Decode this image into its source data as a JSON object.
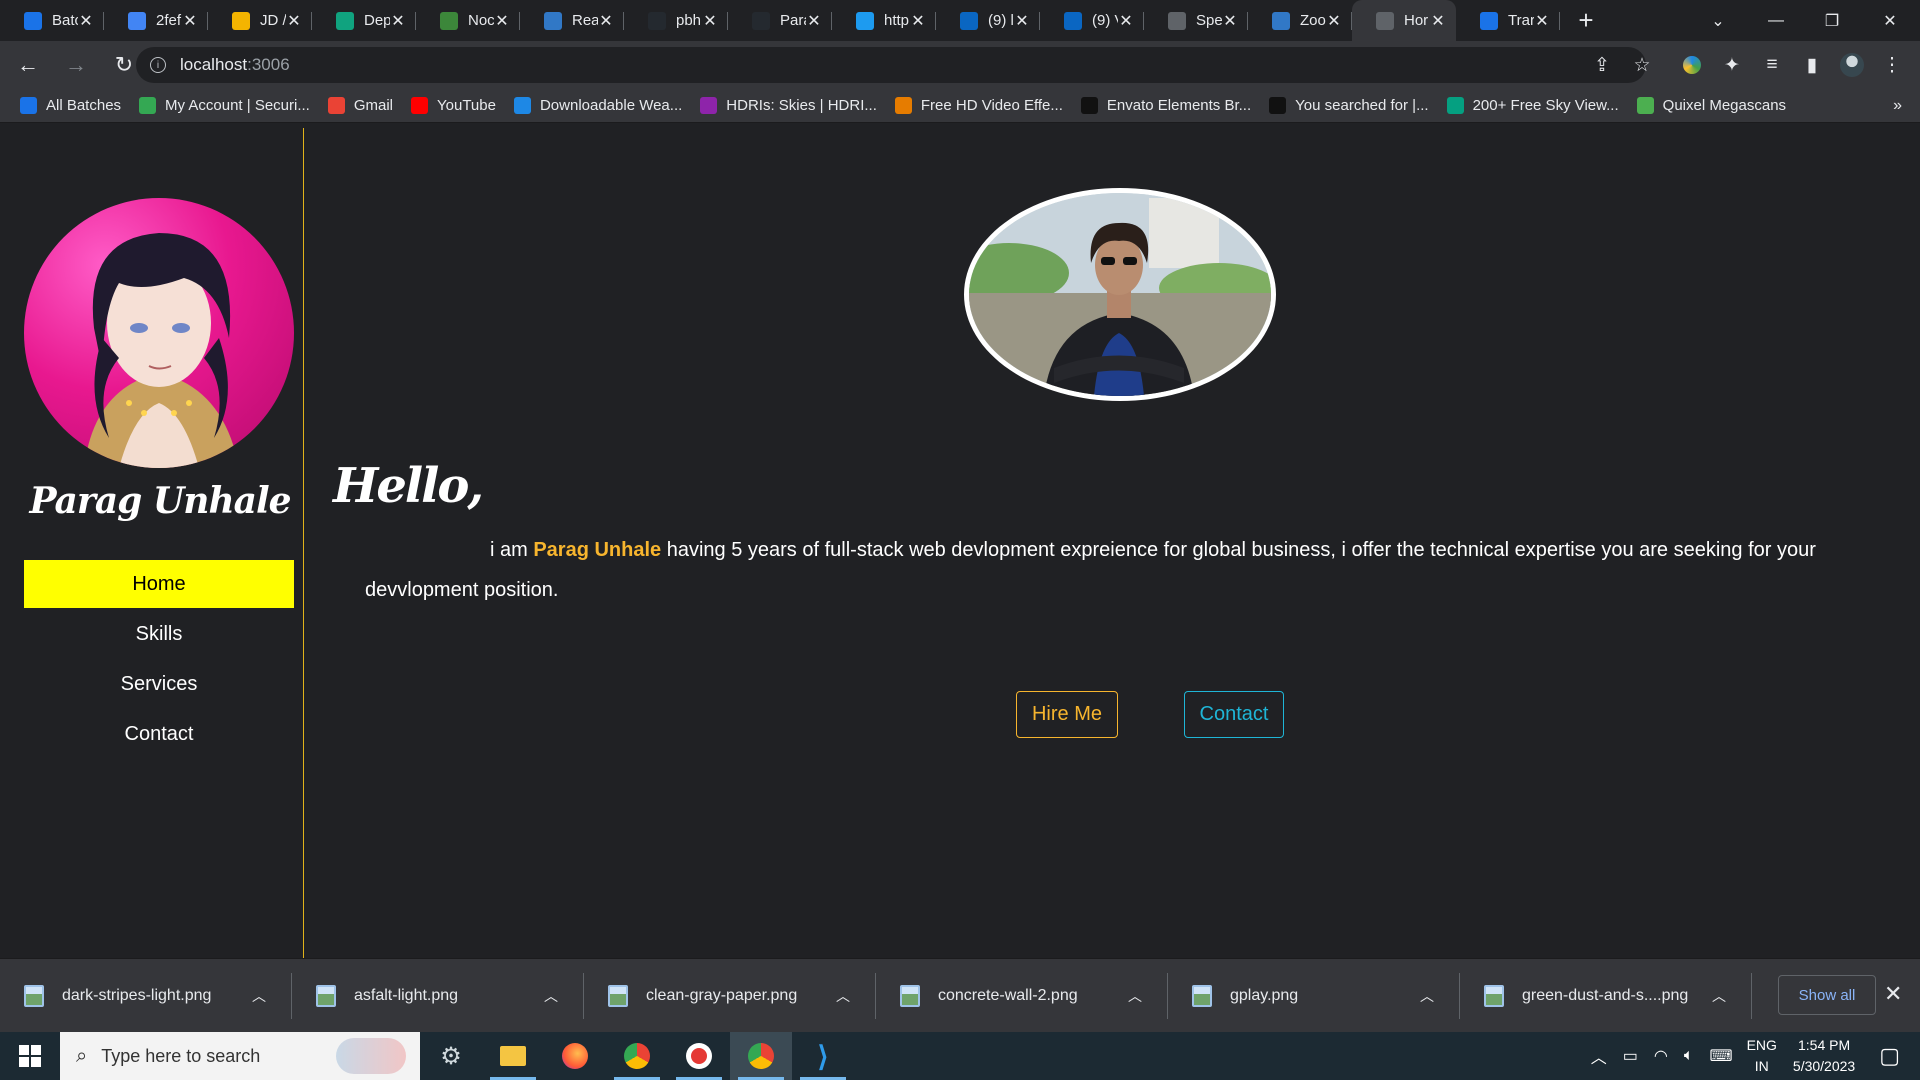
{
  "browser": {
    "tabs": [
      {
        "label": "Batc",
        "icon": "cursor-arrow-icon",
        "color": "#1a73e8"
      },
      {
        "label": "2fef",
        "icon": "docs-icon",
        "color": "#4285f4"
      },
      {
        "label": "JD /",
        "icon": "drive-icon",
        "color": "#f4b400"
      },
      {
        "label": "Dep",
        "icon": "openai-icon",
        "color": "#10a37f"
      },
      {
        "label": "Noc",
        "icon": "nodejs-icon",
        "color": "#3c873a"
      },
      {
        "label": "Rea",
        "icon": "vitejs-icon",
        "color": "#3178c6"
      },
      {
        "label": "pbh",
        "icon": "github-icon",
        "color": "#24292f"
      },
      {
        "label": "Para",
        "icon": "github-icon",
        "color": "#24292f"
      },
      {
        "label": "http",
        "icon": "twitter-icon",
        "color": "#1d9bf0"
      },
      {
        "label": "(9) l",
        "icon": "linkedin-icon",
        "color": "#0a66c2"
      },
      {
        "label": "(9) V",
        "icon": "linkedin-icon",
        "color": "#0a66c2"
      },
      {
        "label": "Spe",
        "icon": "globe-icon",
        "color": "#5f6368"
      },
      {
        "label": "Zoo",
        "icon": "vitejs-icon",
        "color": "#3178c6"
      },
      {
        "label": "Hor",
        "icon": "globe-icon",
        "color": "#5f6368"
      },
      {
        "label": "Trar",
        "icon": "tt-icon",
        "color": "#1a73e8"
      }
    ],
    "url": {
      "host": "localhost",
      "port": ":3006"
    }
  },
  "bookmarks": [
    {
      "label": "All Batches",
      "icon": "cursor-arrow-icon",
      "color": "#1a73e8"
    },
    {
      "label": "My Account | Securi...",
      "icon": "account-icon",
      "color": "#34a853"
    },
    {
      "label": "Gmail",
      "icon": "gmail-icon",
      "color": "#ea4335"
    },
    {
      "label": "YouTube",
      "icon": "youtube-icon",
      "color": "#ff0000"
    },
    {
      "label": "Downloadable Wea...",
      "icon": "weather-icon",
      "color": "#1e88e5"
    },
    {
      "label": "HDRIs: Skies | HDRI...",
      "icon": "hdri-icon",
      "color": "#8e24aa"
    },
    {
      "label": "Free HD Video Effe...",
      "icon": "video-icon",
      "color": "#e67c00"
    },
    {
      "label": "Envato Elements Br...",
      "icon": "tiktok-icon",
      "color": "#111"
    },
    {
      "label": "You searched for |...",
      "icon": "tiktok-icon",
      "color": "#111"
    },
    {
      "label": "200+ Free Sky View...",
      "icon": "pexels-icon",
      "color": "#05a081"
    },
    {
      "label": "Quixel Megascans",
      "icon": "megascans-icon",
      "color": "#4caf50"
    }
  ],
  "sidebar": {
    "name": "Parag Unhale",
    "nav": [
      {
        "label": "Home",
        "active": true
      },
      {
        "label": "Skills",
        "active": false
      },
      {
        "label": "Services",
        "active": false
      },
      {
        "label": "Contact",
        "active": false
      }
    ]
  },
  "main": {
    "greeting": "Hello,",
    "intro_before": "i am ",
    "intro_name": "Parag Unhale",
    "intro_after": " having 5 years of full-stack web devlopment expreience for global business, i offer the technical expertise you are seeking for your devvlopment position.",
    "hire_label": "Hire Me",
    "contact_label": "Contact"
  },
  "downloads": {
    "items": [
      "dark-stripes-light.png",
      "asfalt-light.png",
      "clean-gray-paper.png",
      "concrete-wall-2.png",
      "gplay.png",
      "green-dust-and-s....png"
    ],
    "show_all": "Show all"
  },
  "taskbar": {
    "search_placeholder": "Type here to search",
    "lang_top": "ENG",
    "lang_bottom": "IN",
    "time": "1:54 PM",
    "date": "5/30/2023"
  }
}
